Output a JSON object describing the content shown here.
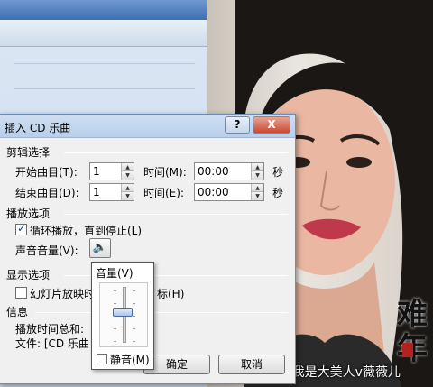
{
  "dialog": {
    "title": "插入 CD 乐曲",
    "help_btn": "?",
    "close_btn": "X",
    "clip_section": "剪辑选择",
    "start_track_label": "开始曲目(T):",
    "start_track_value": "1",
    "start_time_label": "时间(M):",
    "start_time_value": "00:00",
    "start_time_unit": "秒",
    "end_track_label": "结束曲目(D):",
    "end_track_value": "1",
    "end_time_label": "时间(E):",
    "end_time_value": "00:00",
    "end_time_unit": "秒",
    "playback_section": "播放选项",
    "loop_label": "循环播放，直到停止(L)",
    "loop_checked": true,
    "volume_label": "声音音量(V):",
    "display_section": "显示选项",
    "hide_label_left": "幻灯片放映时",
    "hide_label_right": "标(H)",
    "hide_checked": false,
    "info_section": "信息",
    "total_time_label": "播放时间总和:",
    "file_label": "文件: [CD 乐曲",
    "ok": "确定",
    "cancel": "取消"
  },
  "volume_popup": {
    "title": "音量(V)",
    "level_fraction": 0.55,
    "mute_label": "静音(M)",
    "mute_checked": false
  },
  "watermark": "头条号 / 我是大美人v薇薇儿",
  "calligraphy": "难\n年",
  "colors": {
    "titlebar": "#b8cfea",
    "close": "#c94a33",
    "dialog_bg": "#f0f0f0"
  }
}
